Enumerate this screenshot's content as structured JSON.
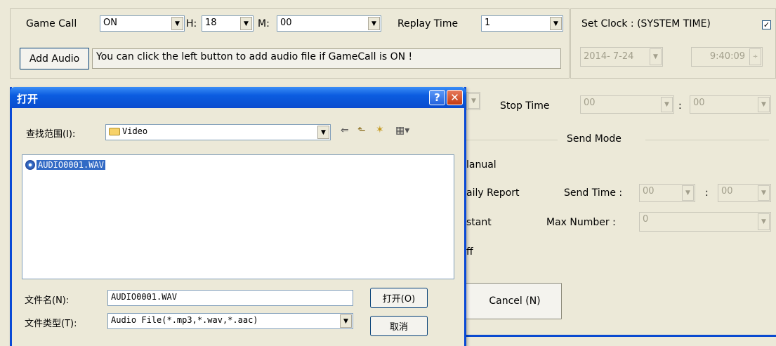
{
  "gamecall": {
    "label": "Game Call",
    "value": "ON",
    "h_label": "H:",
    "h_value": "18",
    "m_label": "M:",
    "m_value": "00",
    "replay_label": "Replay Time",
    "replay_value": "1",
    "add_audio_label": "Add Audio",
    "info_text": "You can click the left button to add audio file if GameCall is ON !"
  },
  "clock": {
    "label": "Set Clock   : (SYSTEM TIME)",
    "checked_mark": "✓",
    "date_value": "2014- 7-24",
    "time_value": "9:40:09"
  },
  "stop": {
    "label": "Stop Time",
    "h_value": "00",
    "sep": ":",
    "m_value": "00"
  },
  "send_mode": {
    "title": "Send Mode",
    "opt_manual": "lanual",
    "opt_daily": "aily Report",
    "send_time_label": "Send Time :",
    "send_time_h": "00",
    "send_time_sep": ":",
    "send_time_m": "00",
    "opt_instant": "stant",
    "max_number_label": "Max Number :",
    "max_number_value": "0",
    "opt_off": "ff",
    "cancel_label": "Cancel (N)"
  },
  "dialog": {
    "title": "打开",
    "help_glyph": "?",
    "close_glyph": "✕",
    "lookin_label": "查找范围(I):",
    "lookin_value": "Video",
    "files": [
      {
        "name": "AUDIO0001.WAV"
      }
    ],
    "filename_label": "文件名(N):",
    "filename_value": "AUDIO0001.WAV",
    "filetype_label": "文件类型(T):",
    "filetype_value": "Audio File(*.mp3,*.wav,*.aac)",
    "open_button": "打开(O)",
    "cancel_button": "取消"
  },
  "icons": {
    "dropdown": "▼",
    "back": "⇐",
    "up_folder": "⬑",
    "new_folder": "✶",
    "view_menu": "▦▾",
    "spin": "÷"
  },
  "colors": {
    "titlebar": "#0a4ad0",
    "selection": "#316ac5",
    "window_bg": "#ece9d8"
  }
}
